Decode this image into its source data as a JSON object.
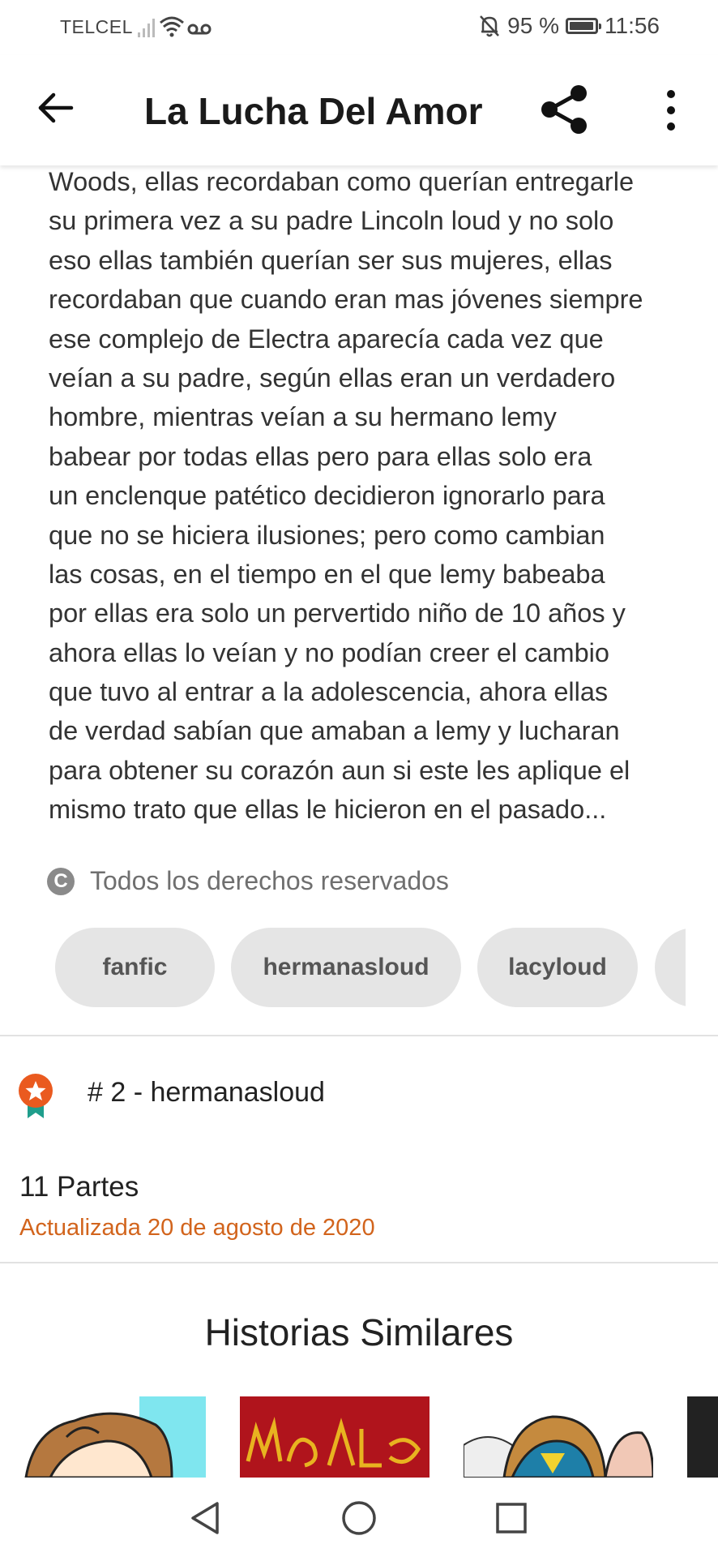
{
  "status": {
    "carrier": "TELCEL",
    "battery": "95 %",
    "time": "11:56"
  },
  "header": {
    "title": "La Lucha Del Amor"
  },
  "description_lines": [
    "Woods, ellas recordaban como querían entregarle",
    "su primera vez a su padre Lincoln loud y no solo",
    "eso ellas también querían ser sus mujeres, ellas",
    "recordaban que cuando eran mas jóvenes siempre",
    "ese complejo de Electra aparecía cada vez que",
    "veían a su padre, según ellas eran un verdadero",
    "hombre, mientras veían a su hermano lemy",
    "babear por todas ellas pero para ellas solo era",
    "un enclenque patético decidieron ignorarlo para",
    "que no se hiciera ilusiones; pero como cambian",
    "las cosas, en el tiempo en el que lemy babeaba",
    "por ellas era solo un pervertido niño de 10 años y",
    "ahora ellas lo veían y no podían creer el cambio",
    "que tuvo al entrar a la adolescencia, ahora ellas",
    "de verdad sabían que amaban a lemy y lucharan",
    "para obtener su corazón aun si este les aplique el",
    "mismo trato que ellas le hicieron en el pasado..."
  ],
  "copyright": {
    "icon_letter": "C",
    "text": "Todos los derechos reservados"
  },
  "tags": [
    "fanfic",
    "hermanasloud",
    "lacyloud"
  ],
  "ranking": {
    "text": "# 2 - hermanasloud",
    "icon": "ranking-medal-icon"
  },
  "story_info": {
    "parts": "11 Partes",
    "updated": "Actualizada 20 de agosto de 2020"
  },
  "similar": {
    "title": "Historias Similares"
  },
  "colors": {
    "accent": "#d2641c",
    "medal": "#ea5a1f",
    "ribbon": "#1f9e8c",
    "tag_bg": "#e5e5e5"
  }
}
